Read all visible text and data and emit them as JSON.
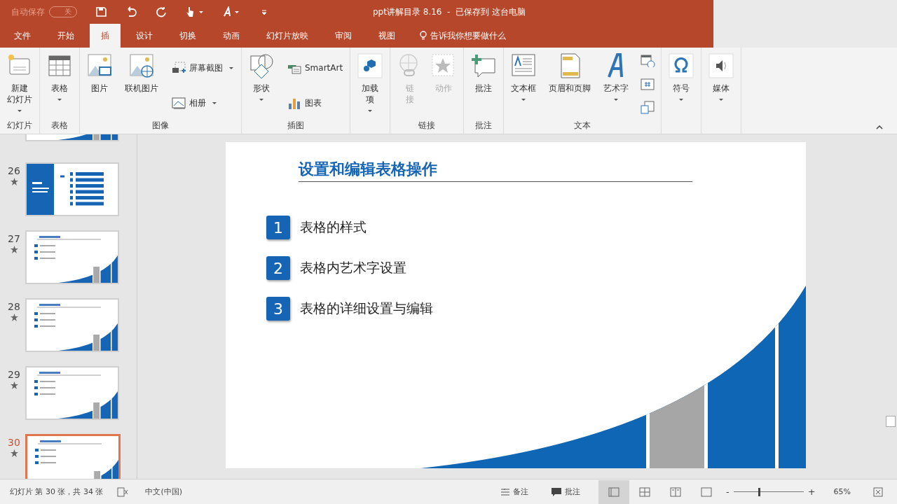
{
  "title_bar": {
    "autosave_label": "自动保存",
    "autosave_state": "关",
    "autosave_on": false,
    "title": "ppt讲解目录 8.16  -  已保存到 这台电脑"
  },
  "tabs": [
    {
      "label": "文件",
      "selected": false
    },
    {
      "label": "开始",
      "selected": false
    },
    {
      "label": "插",
      "selected": true
    },
    {
      "label": "设计",
      "selected": false
    },
    {
      "label": "切换",
      "selected": false
    },
    {
      "label": "动画",
      "selected": false
    },
    {
      "label": "幻灯片放映",
      "selected": false
    },
    {
      "label": "审阅",
      "selected": false
    },
    {
      "label": "视图",
      "selected": false
    }
  ],
  "tell_me": "告诉我你想要做什么",
  "ribbon": [
    {
      "label": "幻灯片",
      "items": [
        {
          "kind": "large",
          "lines": [
            "新建",
            "幻灯片"
          ],
          "dropdown": true,
          "disabled": false
        }
      ]
    },
    {
      "label": "表格",
      "items": [
        {
          "kind": "large",
          "lines": [
            "表格"
          ],
          "dropdown": true,
          "disabled": false
        }
      ]
    },
    {
      "label": "图像",
      "items": [
        {
          "kind": "large",
          "lines": [
            "图片"
          ],
          "dropdown": false,
          "disabled": false
        },
        {
          "kind": "large",
          "lines": [
            "联机图片"
          ],
          "dropdown": false,
          "disabled": false
        },
        {
          "kind": "small",
          "lines": [
            "屏幕截图"
          ],
          "dropdown": true,
          "disabled": false
        },
        {
          "kind": "small",
          "lines": [
            "相册"
          ],
          "dropdown": true,
          "disabled": false
        }
      ]
    },
    {
      "label": "插图",
      "items": [
        {
          "kind": "large",
          "lines": [
            "形状"
          ],
          "dropdown": true,
          "disabled": false
        },
        {
          "kind": "small",
          "lines": [
            "SmartArt"
          ],
          "dropdown": false,
          "disabled": false
        },
        {
          "kind": "small",
          "lines": [
            "图表"
          ],
          "dropdown": false,
          "disabled": false
        }
      ]
    },
    {
      "items": [
        {
          "kind": "large",
          "lines": [
            "加载",
            "项"
          ],
          "dropdown": true,
          "disabled": false
        }
      ]
    },
    {
      "label": "链接",
      "items": [
        {
          "kind": "large",
          "lines": [
            "链",
            "接"
          ],
          "dropdown": false,
          "disabled": true
        },
        {
          "kind": "large",
          "lines": [
            "动作"
          ],
          "dropdown": false,
          "disabled": true
        }
      ]
    },
    {
      "label": "批注",
      "items": [
        {
          "kind": "large",
          "lines": [
            "批注"
          ],
          "dropdown": false,
          "disabled": false
        }
      ]
    },
    {
      "label": "文本",
      "items": [
        {
          "kind": "large",
          "lines": [
            "文本框"
          ],
          "dropdown": true,
          "disabled": false
        },
        {
          "kind": "large",
          "lines": [
            "页眉和页脚"
          ],
          "dropdown": false,
          "disabled": false
        },
        {
          "kind": "large",
          "lines": [
            "艺术字"
          ],
          "dropdown": true,
          "disabled": false
        },
        {
          "kind": "icon"
        },
        {
          "kind": "icon"
        },
        {
          "kind": "icon"
        }
      ]
    },
    {
      "items": [
        {
          "kind": "large",
          "lines": [
            "符号"
          ],
          "dropdown": true,
          "disabled": false
        }
      ]
    },
    {
      "items": [
        {
          "kind": "large",
          "lines": [
            "媒体"
          ],
          "dropdown": true,
          "disabled": false
        }
      ]
    }
  ],
  "slides": [
    {
      "kind": "content",
      "selected": false
    },
    {
      "number": "26",
      "kind": "section",
      "selected": false
    },
    {
      "number": "27",
      "kind": "content",
      "selected": false
    },
    {
      "number": "28",
      "kind": "content",
      "selected": false
    },
    {
      "number": "29",
      "kind": "content",
      "selected": false
    },
    {
      "number": "30",
      "kind": "content",
      "selected": true
    }
  ],
  "slide": {
    "title": "设置和编辑表格操作",
    "items": [
      {
        "number": "1",
        "text": "表格的样式"
      },
      {
        "number": "2",
        "text": "表格内艺术字设置"
      },
      {
        "number": "3",
        "text": "表格的详细设置与编辑"
      }
    ]
  },
  "status_bar": {
    "slide_info": "幻灯片 第 30 张，共 34 张",
    "language": "中文(中国)",
    "notes": "备注",
    "comments": "批注",
    "views": [
      {
        "selected": true
      },
      {
        "selected": false
      },
      {
        "selected": false
      },
      {
        "selected": false
      }
    ],
    "zoom_minus": "-",
    "zoom_plus": "+",
    "zoom": {
      "level": 0.35
    },
    "zoom_text": "65%"
  }
}
